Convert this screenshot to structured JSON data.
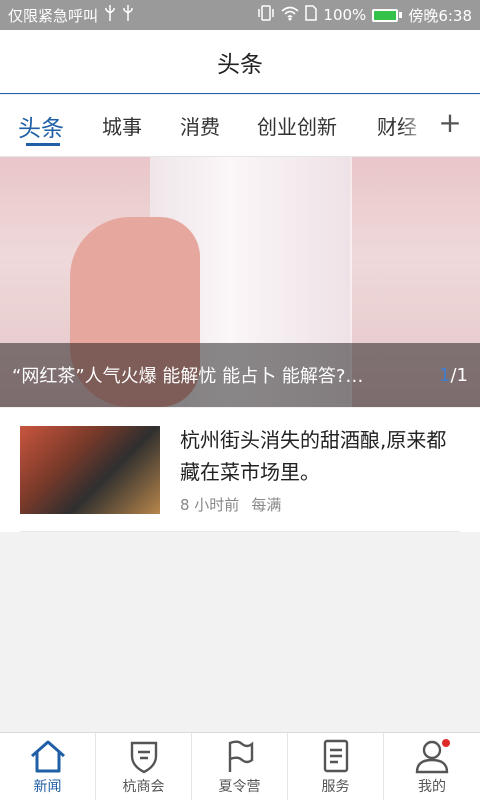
{
  "status_bar": {
    "emergency_text": "仅限紧急呼叫",
    "battery_percent": "100%",
    "time": "傍晚6:38",
    "icons": [
      "usb-icon",
      "usb-icon",
      "vibrate-icon",
      "wifi-icon",
      "sim-icon",
      "battery-icon"
    ]
  },
  "header": {
    "title": "头条"
  },
  "tabs": [
    {
      "label": "头条",
      "active": true
    },
    {
      "label": "城事"
    },
    {
      "label": "消费"
    },
    {
      "label": "创业创新"
    },
    {
      "label": "财经"
    }
  ],
  "add_tab_label": "+",
  "hero": {
    "caption": "“网红茶”人气火爆 能解忧 能占卜 能解答?…",
    "pager_current": "1",
    "pager_total": "/1"
  },
  "news": [
    {
      "headline": "杭州街头消失的甜酒酿,原来都藏在菜市场里。",
      "time": "8 小时前",
      "source": "每满"
    }
  ],
  "bottom_nav": [
    {
      "label": "新闻",
      "icon": "home-icon",
      "active": true
    },
    {
      "label": "杭商会",
      "icon": "shield-icon"
    },
    {
      "label": "夏令营",
      "icon": "flag-icon"
    },
    {
      "label": "服务",
      "icon": "document-icon"
    },
    {
      "label": "我的",
      "icon": "user-icon",
      "badge": true
    }
  ],
  "colors": {
    "accent": "#1f5fa6",
    "badge": "#e02a2a"
  }
}
